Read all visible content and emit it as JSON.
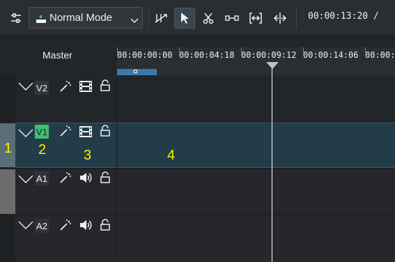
{
  "toolbar": {
    "mode": "Normal Mode",
    "timecode": "00:00:13:20 /"
  },
  "ruler": {
    "master_label": "Master",
    "ticks": [
      "00:00:00:00",
      "00:00:04:18",
      "00:00:09:12",
      "00:00:14:06",
      "00:00:1"
    ]
  },
  "tracks": [
    {
      "name": "V2"
    },
    {
      "name": "V1"
    },
    {
      "name": "A1"
    },
    {
      "name": "A2"
    }
  ],
  "annotations": [
    "1",
    "2",
    "3",
    "4"
  ],
  "colors": {
    "selected_track": "#233c4a",
    "active_name": "#3fbf6f",
    "annotation": "#f5f500",
    "playhead": "#ffffff"
  }
}
